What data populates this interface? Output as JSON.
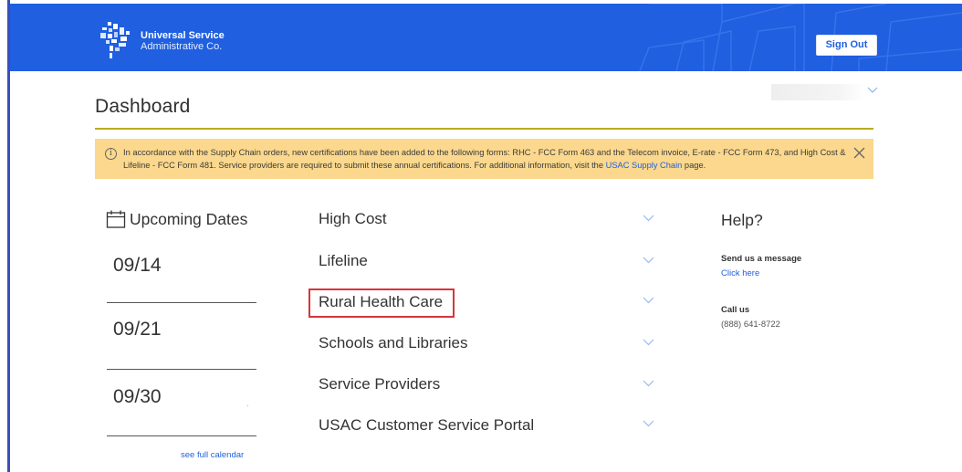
{
  "header": {
    "org_name_line1": "Universal Service",
    "org_name_line2": "Administrative Co.",
    "sign_out_label": "Sign Out",
    "brand_color": "#1f5fe0"
  },
  "page": {
    "title": "Dashboard"
  },
  "alert": {
    "text_before_link": "In accordance with the Supply Chain orders, new certifications have been added to the following forms: RHC - FCC Form 463 and the Telecom invoice, E-rate - FCC Form 473, and High Cost & Lifeline - FCC Form 481. Service providers are required to submit these annual certifications. For additional information, visit the ",
    "link_text": "USAC Supply Chain",
    "text_after_link": " page.",
    "icon": "info-circle-icon",
    "background_color": "#fbd88d"
  },
  "upcoming": {
    "title": "Upcoming Dates",
    "dates": [
      "09/14",
      "09/21",
      "09/30"
    ],
    "see_full_calendar": "see full calendar"
  },
  "programs": [
    {
      "label": "High Cost"
    },
    {
      "label": "Lifeline"
    },
    {
      "label": "Rural Health Care",
      "highlighted": true
    },
    {
      "label": "Schools and Libraries"
    },
    {
      "label": "Service Providers"
    },
    {
      "label": "USAC Customer Service Portal"
    }
  ],
  "help": {
    "title": "Help?",
    "message_label": "Send us a message",
    "message_link": "Click here",
    "call_label": "Call us",
    "phone": "(888) 641-8722"
  },
  "colors": {
    "accent_rule": "#b8ad1e",
    "highlight_border": "#d9343a",
    "link": "#1f5fe0"
  }
}
